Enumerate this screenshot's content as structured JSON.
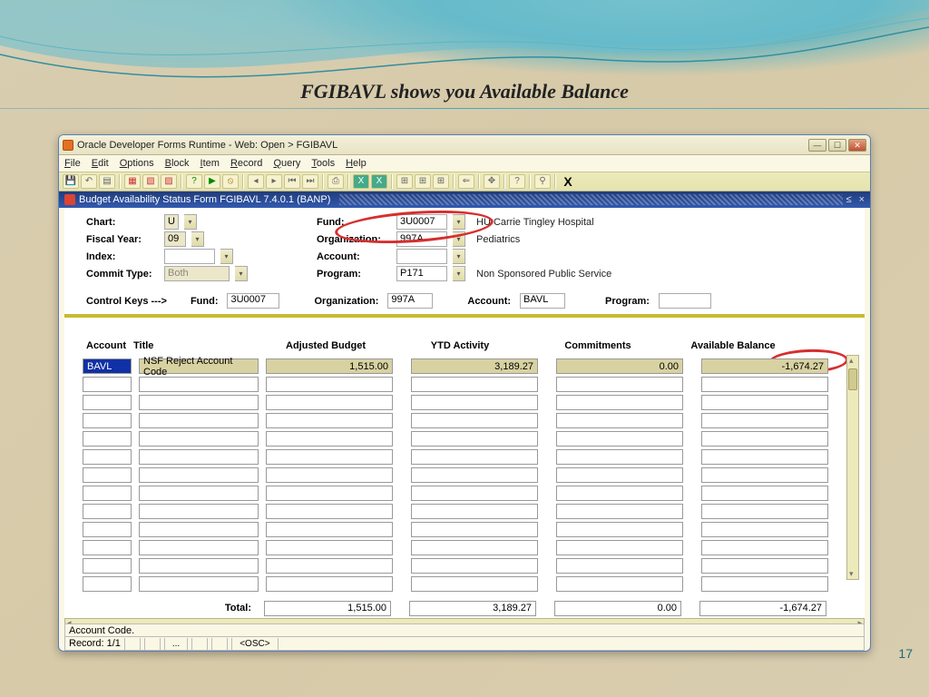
{
  "slide": {
    "title": "FGIBAVL shows you Available Balance",
    "page": "17"
  },
  "window": {
    "title": "Oracle Developer Forms Runtime - Web: Open > FGIBAVL",
    "menus": [
      "File",
      "Edit",
      "Options",
      "Block",
      "Item",
      "Record",
      "Query",
      "Tools",
      "Help"
    ],
    "toolbar_x": "X",
    "form_title": "Budget Availability Status Form  FGIBAVL  7.4.0.1  (BANP)"
  },
  "header": {
    "chart": {
      "label": "Chart:",
      "value": "U"
    },
    "fiscal_year": {
      "label": "Fiscal Year:",
      "value": "09"
    },
    "index": {
      "label": "Index:",
      "value": ""
    },
    "commit_type": {
      "label": "Commit Type:",
      "value": "Both"
    },
    "fund": {
      "label": "Fund:",
      "value": "3U0007",
      "desc": "HU Carrie Tingley Hospital"
    },
    "org": {
      "label": "Organization:",
      "value": "997A",
      "desc": "Pediatrics"
    },
    "account": {
      "label": "Account:",
      "value": ""
    },
    "program": {
      "label": "Program:",
      "value": "P171",
      "desc": "Non Sponsored Public Service"
    }
  },
  "control_keys": {
    "label": "Control Keys  --->",
    "fund": {
      "label": "Fund:",
      "value": "3U0007"
    },
    "org": {
      "label": "Organization:",
      "value": "997A"
    },
    "account": {
      "label": "Account:",
      "value": "BAVL"
    },
    "program": {
      "label": "Program:",
      "value": ""
    }
  },
  "columns": {
    "account": "Account",
    "title": "Title",
    "adjusted": "Adjusted Budget",
    "ytd": "YTD Activity",
    "commit": "Commitments",
    "avail": "Available Balance"
  },
  "rows": [
    {
      "account": "BAVL",
      "title": "NSF Reject Account Code",
      "adjusted": "1,515.00",
      "ytd": "3,189.27",
      "commit": "0.00",
      "avail": "-1,674.27"
    }
  ],
  "totals": {
    "label": "Total:",
    "adjusted": "1,515.00",
    "ytd": "3,189.27",
    "commit": "0.00",
    "avail": "-1,674.27"
  },
  "status": {
    "message": "Account Code.",
    "record": "Record: 1/1",
    "segs": [
      "",
      "",
      "...",
      "",
      "",
      "<OSC>"
    ]
  }
}
